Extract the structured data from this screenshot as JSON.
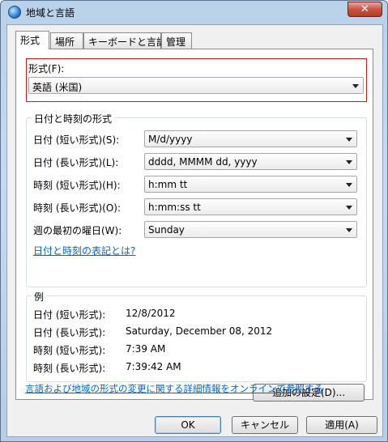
{
  "window": {
    "title": "地域と言語",
    "close_glyph": "✕"
  },
  "tabs": [
    "形式",
    "場所",
    "キーボードと言語",
    "管理"
  ],
  "format": {
    "label": "形式(F):",
    "value": "英語 (米国)"
  },
  "datetime_group": {
    "title": "日付と時刻の形式",
    "rows": [
      {
        "label": "日付 (短い形式)(S):",
        "value": "M/d/yyyy"
      },
      {
        "label": "日付 (長い形式)(L):",
        "value": "dddd, MMMM dd, yyyy"
      },
      {
        "label": "時刻 (短い形式)(H):",
        "value": "h:mm tt"
      },
      {
        "label": "時刻 (長い形式)(O):",
        "value": "h:mm:ss tt"
      },
      {
        "label": "週の最初の曜日(W):",
        "value": "Sunday"
      }
    ],
    "help_link": "日付と時刻の表記とは?"
  },
  "example_group": {
    "title": "例",
    "rows": [
      {
        "label": "日付 (短い形式):",
        "value": "12/8/2012"
      },
      {
        "label": "日付 (長い形式):",
        "value": "Saturday, December 08, 2012"
      },
      {
        "label": "時刻 (短い形式):",
        "value": "7:39 AM"
      },
      {
        "label": "時刻 (長い形式):",
        "value": "7:39:42 AM"
      }
    ]
  },
  "additional_settings_button": "追加の設定(D)...",
  "online_link": "言語および地域の形式の変更に関する詳細情報をオンラインで参照する",
  "footer": {
    "ok": "OK",
    "cancel": "キャンセル",
    "apply": "適用(A)"
  }
}
